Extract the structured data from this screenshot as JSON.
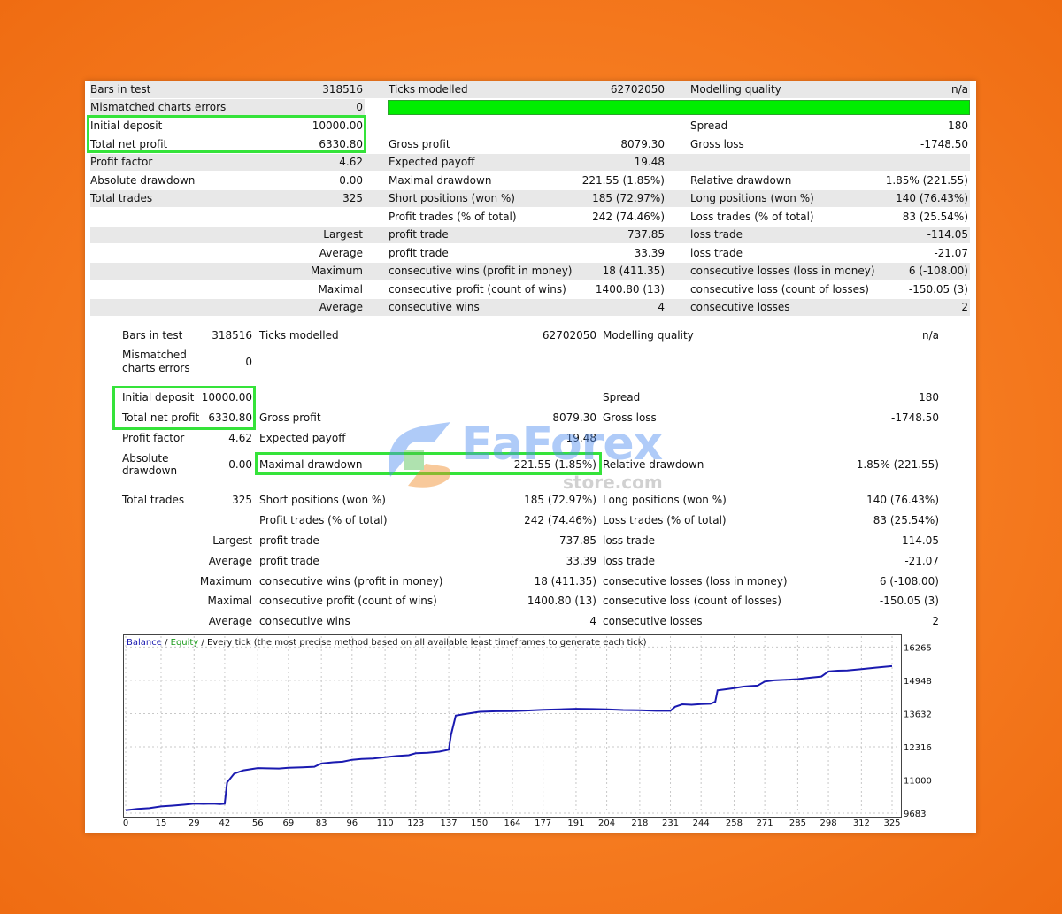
{
  "report1": {
    "rows": [
      {
        "cells": [
          "Bars in test",
          "318516",
          "Ticks modelled",
          "62702050",
          "Modelling quality",
          "n/a"
        ]
      },
      {
        "cells": [
          "Mismatched charts errors",
          "0",
          "",
          "",
          "",
          ""
        ]
      },
      {
        "cells": [
          "Initial deposit",
          "10000.00",
          "",
          "",
          "Spread",
          "180"
        ]
      },
      {
        "cells": [
          "Total net profit",
          "6330.80",
          "Gross profit",
          "8079.30",
          "Gross loss",
          "-1748.50"
        ]
      },
      {
        "cells": [
          "Profit factor",
          "4.62",
          "Expected payoff",
          "19.48",
          "",
          ""
        ]
      },
      {
        "cells": [
          "Absolute drawdown",
          "0.00",
          "Maximal drawdown",
          "221.55 (1.85%)",
          "Relative drawdown",
          "1.85% (221.55)"
        ]
      },
      {
        "cells": [
          "Total trades",
          "325",
          "Short positions (won %)",
          "185 (72.97%)",
          "Long positions (won %)",
          "140 (76.43%)"
        ]
      },
      {
        "cells": [
          "",
          "",
          "Profit trades (% of total)",
          "242 (74.46%)",
          "Loss trades (% of total)",
          "83 (25.54%)"
        ]
      },
      {
        "cells": [
          "",
          "Largest",
          "profit trade",
          "737.85",
          "loss trade",
          "-114.05"
        ]
      },
      {
        "cells": [
          "",
          "Average",
          "profit trade",
          "33.39",
          "loss trade",
          "-21.07"
        ]
      },
      {
        "cells": [
          "",
          "Maximum",
          "consecutive wins (profit in money)",
          "18 (411.35)",
          "consecutive losses (loss in money)",
          "6 (-108.00)"
        ]
      },
      {
        "cells": [
          "",
          "Maximal",
          "consecutive profit (count of wins)",
          "1400.80 (13)",
          "consecutive loss (count of losses)",
          "-150.05 (3)"
        ]
      },
      {
        "cells": [
          "",
          "Average",
          "consecutive wins",
          "4",
          "consecutive losses",
          "2"
        ]
      }
    ]
  },
  "report2": {
    "bars_label": "Bars in test",
    "bars_value": "318516",
    "ticks_label": "Ticks modelled",
    "ticks_value": "62702050",
    "quality_label": "Modelling quality",
    "quality_value": "n/a",
    "mismatch_label_1": "Mismatched",
    "mismatch_label_2": "charts errors",
    "mismatch_value": "0",
    "deposit_label": "Initial deposit",
    "deposit_value": "10000.00",
    "spread_label": "Spread",
    "spread_value": "180",
    "netprofit_label": "Total net profit",
    "netprofit_value": "6330.80",
    "gross_profit_label": "Gross profit",
    "gross_profit_value": "8079.30",
    "gross_loss_label": "Gross loss",
    "gross_loss_value": "-1748.50",
    "pf_label": "Profit factor",
    "pf_value": "4.62",
    "payoff_label": "Expected payoff",
    "payoff_value": "19.48",
    "absdd_label_1": "Absolute",
    "absdd_label_2": "drawdown",
    "absdd_value": "0.00",
    "maxdd_label": "Maximal drawdown",
    "maxdd_value": "221.55 (1.85%)",
    "reldd_label": "Relative drawdown",
    "reldd_value": "1.85% (221.55)",
    "trades_label": "Total trades",
    "trades_value": "325",
    "short_label": "Short positions (won %)",
    "short_value": "185 (72.97%)",
    "long_label": "Long positions (won %)",
    "long_value": "140 (76.43%)",
    "ptrades_label": "Profit trades (% of total)",
    "ptrades_value": "242 (74.46%)",
    "ltrades_label": "Loss trades (% of total)",
    "ltrades_value": "83 (25.54%)",
    "largest": "Largest",
    "largest_pl": "profit trade",
    "largest_pv": "737.85",
    "largest_ll": "loss trade",
    "largest_lv": "-114.05",
    "average": "Average",
    "average_pl": "profit trade",
    "average_pv": "33.39",
    "average_ll": "loss trade",
    "average_lv": "-21.07",
    "maximum": "Maximum",
    "maximum_pl": "consecutive wins (profit in money)",
    "maximum_pv": "18 (411.35)",
    "maximum_ll": "consecutive losses (loss in money)",
    "maximum_lv": "6 (-108.00)",
    "maximal": "Maximal",
    "maximal_pl": "consecutive profit (count of wins)",
    "maximal_pv": "1400.80 (13)",
    "maximal_ll": "consecutive loss (count of losses)",
    "maximal_lv": "-150.05 (3)",
    "average2": "Average",
    "average2_pl": "consecutive wins",
    "average2_pv": "4",
    "average2_ll": "consecutive losses",
    "average2_lv": "2"
  },
  "watermark": {
    "brand": "EaForex",
    "sub": "store.com"
  },
  "chart_title": {
    "balance": "Balance",
    "sep1": " / ",
    "equity": "Equity",
    "rest": " / Every tick (the most precise method based on all available least timeframes to generate each tick)"
  },
  "colors": {
    "highlight": "#35e33a",
    "quality_bar": "#00ee00",
    "balance_line": "#1a1ab0",
    "equity_line": "#1a9a1a"
  },
  "chart_data": {
    "type": "line",
    "title": "",
    "xlabel": "",
    "ylabel": "",
    "x_ticks": [
      0,
      15,
      29,
      42,
      56,
      69,
      83,
      96,
      110,
      123,
      137,
      150,
      164,
      177,
      191,
      204,
      218,
      231,
      244,
      258,
      271,
      285,
      298,
      312,
      325
    ],
    "y_ticks": [
      9683,
      11000,
      12316,
      13632,
      14948,
      16265
    ],
    "xlim": [
      0,
      328
    ],
    "ylim": [
      9683,
      16700
    ],
    "grid": true,
    "series": [
      {
        "name": "Balance",
        "x": [
          0,
          5,
          10,
          15,
          20,
          25,
          29,
          33,
          37,
          40,
          42,
          43,
          46,
          50,
          56,
          60,
          65,
          69,
          75,
          80,
          83,
          88,
          92,
          96,
          100,
          105,
          110,
          115,
          120,
          123,
          128,
          133,
          137,
          138,
          140,
          143,
          150,
          157,
          164,
          170,
          177,
          184,
          191,
          198,
          204,
          211,
          218,
          225,
          231,
          233,
          236,
          240,
          244,
          248,
          250,
          251,
          255,
          258,
          262,
          265,
          268,
          271,
          275,
          280,
          285,
          290,
          295,
          298,
          302,
          306,
          312,
          318,
          325
        ],
        "y": [
          9800,
          9850,
          9880,
          9950,
          9980,
          10020,
          10060,
          10050,
          10060,
          10040,
          10060,
          10900,
          11250,
          11380,
          11470,
          11460,
          11450,
          11480,
          11500,
          11520,
          11650,
          11700,
          11720,
          11800,
          11830,
          11850,
          11900,
          11950,
          11980,
          12060,
          12080,
          12120,
          12200,
          12800,
          13550,
          13600,
          13700,
          13720,
          13730,
          13750,
          13780,
          13800,
          13820,
          13810,
          13800,
          13770,
          13760,
          13740,
          13740,
          13900,
          14000,
          13980,
          14010,
          14020,
          14100,
          14550,
          14600,
          14640,
          14700,
          14720,
          14740,
          14900,
          14950,
          14970,
          15000,
          15050,
          15100,
          15300,
          15330,
          15340,
          15390,
          15450,
          15510
        ]
      }
    ]
  }
}
